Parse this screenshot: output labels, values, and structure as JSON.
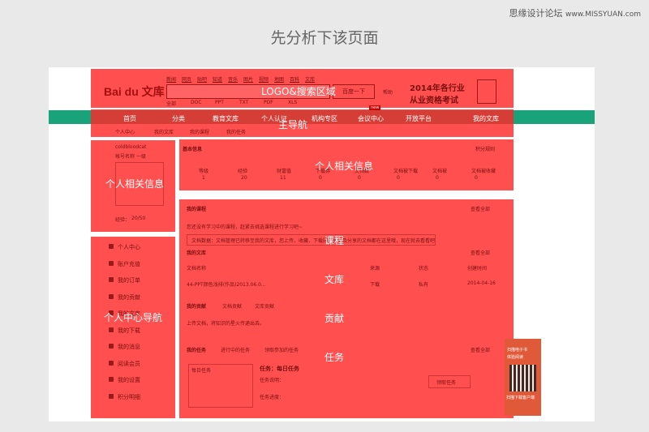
{
  "site": "思缘设计论坛",
  "watermark_url": "www.MISSYUAN.com",
  "heading": "先分析下该页面",
  "logo": "Bai du 文库",
  "search_tabs": [
    "新闻",
    "网页",
    "贴吧",
    "知道",
    "音乐",
    "图片",
    "视频",
    "地图",
    "百科",
    "文库"
  ],
  "search_button": "百度一下",
  "help_link": "帮助",
  "formats": [
    "全部",
    "DOC",
    "PPT",
    "TXT",
    "PDF",
    "XLS"
  ],
  "ad": {
    "line1": "2014年各行业",
    "line2": "从业资格考试"
  },
  "nav": [
    "首页",
    "分类",
    "教育文库",
    "个人认证",
    "机构专区",
    "会议中心",
    "开放平台",
    "我的文库"
  ],
  "nav_badge": "new",
  "subnav": [
    "个人中心",
    "我的文库",
    "我的课程",
    "我的任务"
  ],
  "profile": {
    "name": "coldbloodcat",
    "levels": "帐号名称   一级",
    "exp": "经验：",
    "exp_value": "20/50"
  },
  "basic_info": {
    "title": "基本信息",
    "link": "积分规则",
    "columns": [
      "等级",
      "经验",
      "财富值",
      "下载券",
      "文档数",
      "文档被下载",
      "文档被",
      "文档被收藏"
    ],
    "values": [
      "1",
      "20",
      "11",
      "0",
      "0",
      "0",
      "0",
      "0"
    ]
  },
  "side_nav": [
    "个人中心",
    "账户充值",
    "我的订单",
    "我的贡献",
    "我的文库",
    "我的下载",
    "我的消息",
    "阅读会员",
    "我的设置",
    "积分明细"
  ],
  "courses": {
    "title": "我的课程",
    "link": "查看全部",
    "desc": "您还没有学习中的课程，赶紧去挑选课程进行学习吧~",
    "notice": "文档数据：文档管理已转移至我的文库，您上传、收藏、下载的文档以及分享的文档都在这里哦，现在就去看看吧"
  },
  "library": {
    "title": "我的文库",
    "link": "查看全部",
    "columns": [
      "文档名称",
      "来源",
      "状态",
      "创建时间"
    ],
    "row": [
      "44-PPT颜色浅排(作品)2013.06.0...",
      "下载",
      "私有",
      "2014-04-16"
    ]
  },
  "contribution": {
    "title": "我的贡献",
    "tabs": [
      "文档贡献",
      "文库贡献"
    ],
    "desc": "上传文档，将知识的星火传递出去。"
  },
  "tasks": {
    "title": "我的任务",
    "tabs": [
      "进行中的任务",
      "领取参加的任务"
    ],
    "link": "查看全部",
    "daily": "每日任务",
    "task_name": "任务：每日任务",
    "task_desc": "任务说明：",
    "task_progress": "任务进度：",
    "button": "领取任务"
  },
  "qr": {
    "top": "扫描电子书",
    "sub": "体验阅读",
    "bottom": "扫描下载客户端"
  },
  "labels": {
    "logo_search": "LOGO&搜索区域",
    "main_nav": "主导航",
    "personal_info": "个人相关信息",
    "personal_info_left": "个人相关信息",
    "course": "课程",
    "library": "文库",
    "contrib": "贡献",
    "task": "任务",
    "side_nav": "个人中心导航"
  },
  "colors": {
    "overlay": "#ff2828",
    "nav_green": "#1aa37a",
    "canvas": "#ffffff",
    "background": "#e9e9e9"
  }
}
